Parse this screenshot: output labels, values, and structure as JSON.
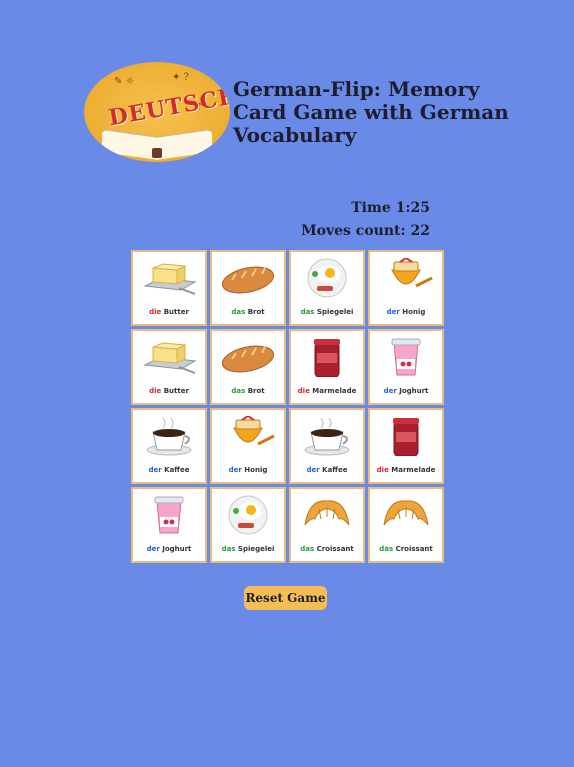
{
  "logo": {
    "word": "DEUTSCH"
  },
  "header": {
    "title": "German-Flip: Memory Card Game with German Vocabulary"
  },
  "stats": {
    "time": "Time 1:25",
    "moves": "Moves count: 22"
  },
  "colors": {
    "der": "#2b5fd9",
    "die": "#d22b2b",
    "das": "#2a9a3a"
  },
  "cards": [
    {
      "icon": "butter-icon",
      "article": "die",
      "noun": "Butter"
    },
    {
      "icon": "bread-icon",
      "article": "das",
      "noun": "Brot"
    },
    {
      "icon": "fried-egg-icon",
      "article": "das",
      "noun": "Spiegelei"
    },
    {
      "icon": "honey-icon",
      "article": "der",
      "noun": "Honig"
    },
    {
      "icon": "butter-icon",
      "article": "die",
      "noun": "Butter"
    },
    {
      "icon": "bread-icon",
      "article": "das",
      "noun": "Brot"
    },
    {
      "icon": "jam-icon",
      "article": "die",
      "noun": "Marmelade"
    },
    {
      "icon": "yogurt-icon",
      "article": "der",
      "noun": "Joghurt"
    },
    {
      "icon": "coffee-icon",
      "article": "der",
      "noun": "Kaffee"
    },
    {
      "icon": "honey-icon",
      "article": "der",
      "noun": "Honig"
    },
    {
      "icon": "coffee-icon",
      "article": "der",
      "noun": "Kaffee"
    },
    {
      "icon": "jam-icon",
      "article": "die",
      "noun": "Marmelade"
    },
    {
      "icon": "yogurt-icon",
      "article": "der",
      "noun": "Joghurt"
    },
    {
      "icon": "fried-egg-icon",
      "article": "das",
      "noun": "Spiegelei"
    },
    {
      "icon": "croissant-icon",
      "article": "das",
      "noun": "Croissant"
    },
    {
      "icon": "croissant-icon",
      "article": "das",
      "noun": "Croissant"
    }
  ],
  "controls": {
    "reset_label": "Reset Game"
  }
}
